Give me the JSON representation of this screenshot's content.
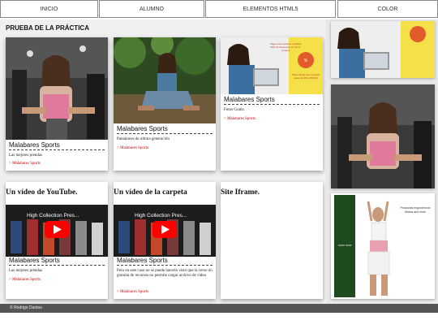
{
  "nav": {
    "items": [
      "INICIO",
      "ALUMNO",
      "ELEMENTOS HTML5",
      "COLOR"
    ]
  },
  "main": {
    "page_title": "PRUEBA DE LA PRÁCTICA",
    "cards": [
      {
        "title": "Malabares Sports",
        "desc": "Las mejores prendas",
        "link": "> Malabares Sports"
      },
      {
        "title": "Malabares Sports",
        "desc": "Pantalones de ultima generación",
        "link": "> Malabares Sports"
      },
      {
        "title": "Malabares Sports",
        "desc": "Fotos Gratis.",
        "link": "> Malabares Sports"
      },
      {
        "title": "Malabares Sports",
        "desc": "Las mejores prendas",
        "link": "> Malabares Sports"
      },
      {
        "title": "Malabares Sports",
        "desc": "Pero en este caso no se puede hacerlo visto que la verso ón gratuita de recursos no permite cargar archivo de video",
        "link": "> Malabares Sports"
      }
    ],
    "section_headings": [
      "Un vídeo de YouTube.",
      "Un vídeo de la carpeta",
      "Site Iframe."
    ],
    "video_title": "High Collection Pres...",
    "ad": {
      "line1": "Paga a tus estudios o gastos 50% de descuento en tus 1° compra",
      "line2": "Prime Studio tus compras antes de 9/6 LABURO"
    },
    "promo": {
      "badge": "SHOP NOW",
      "text": "Productos ergonómicos fitness and more"
    }
  },
  "footer": {
    "text": "© Rodrigo Dantas"
  },
  "colors": {
    "link": "#cc0000",
    "main_bg": "#f0f0f0",
    "footer_bg": "#555555",
    "ad_yellow": "#f5e04a",
    "yt_red": "#ff0000"
  }
}
